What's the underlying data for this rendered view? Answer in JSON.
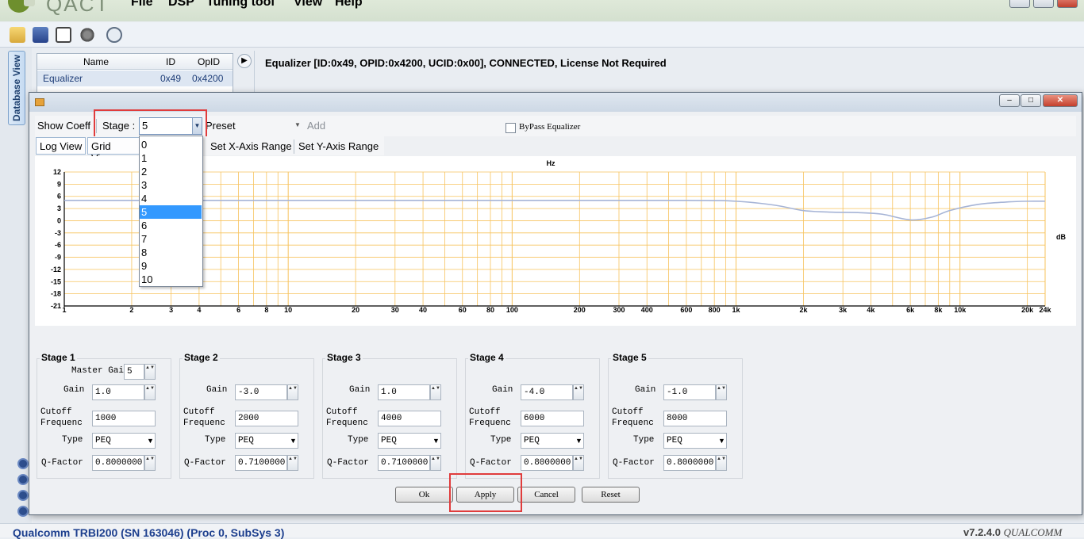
{
  "app": {
    "name": "QACT",
    "menu": [
      "File",
      "DSP",
      "Tuning tool",
      "View",
      "Help"
    ]
  },
  "sidebar": {
    "tab_label": "Database View"
  },
  "module_grid": {
    "headers": [
      "Name",
      "ID",
      "OpID"
    ],
    "rows": [
      {
        "name": "Equalizer",
        "id": "0x49",
        "opid": "0x4200"
      }
    ]
  },
  "main": {
    "header": "Equalizer [ID:0x49, OPID:0x4200, UCID:0x00], CONNECTED, License Not Required"
  },
  "dialog": {
    "toolbar": {
      "show_coeff": "Show Coeff",
      "stage_label": "Stage :",
      "stage_value": "5",
      "preset_label": "Preset",
      "add_label": "Add",
      "bypass_label": "ByPass Equalizer",
      "log_view": "Log View",
      "grid_view": "Grid View",
      "set_x": "Set X-Axis Range",
      "set_y": "Set Y-Axis Range"
    },
    "stage_options": [
      "0",
      "1",
      "2",
      "3",
      "4",
      "5",
      "6",
      "7",
      "8",
      "9",
      "10"
    ],
    "stage_selected_index": 5,
    "stages": [
      {
        "title": "Stage 1",
        "master_gain_label": "Master Gai",
        "master_gain": "5",
        "gain_label": "Gain",
        "gain": "1.0",
        "cutoff_label1": "Cutoff",
        "cutoff_label2": "Frequenc",
        "cutoff": "1000",
        "type_label": "Type",
        "type": "PEQ",
        "q_label": "Q-Factor",
        "q": "0.8000000"
      },
      {
        "title": "Stage 2",
        "gain_label": "Gain",
        "gain": "-3.0",
        "cutoff_label1": "Cutoff",
        "cutoff_label2": "Frequenc",
        "cutoff": "2000",
        "type_label": "Type",
        "type": "PEQ",
        "q_label": "Q-Factor",
        "q": "0.7100000"
      },
      {
        "title": "Stage 3",
        "gain_label": "Gain",
        "gain": "1.0",
        "cutoff_label1": "Cutoff",
        "cutoff_label2": "Frequenc",
        "cutoff": "4000",
        "type_label": "Type",
        "type": "PEQ",
        "q_label": "Q-Factor",
        "q": "0.7100000"
      },
      {
        "title": "Stage 4",
        "gain_label": "Gain",
        "gain": "-4.0",
        "cutoff_label1": "Cutoff",
        "cutoff_label2": "Frequenc",
        "cutoff": "6000",
        "type_label": "Type",
        "type": "PEQ",
        "q_label": "Q-Factor",
        "q": "0.8000000"
      },
      {
        "title": "Stage 5",
        "gain_label": "Gain",
        "gain": "-1.0",
        "cutoff_label1": "Cutoff",
        "cutoff_label2": "Frequenc",
        "cutoff": "8000",
        "type_label": "Type",
        "type": "PEQ",
        "q_label": "Q-Factor",
        "q": "0.8000000"
      }
    ],
    "buttons": {
      "ok": "Ok",
      "apply": "Apply",
      "cancel": "Cancel",
      "reset": "Reset"
    }
  },
  "status": {
    "left": "Qualcomm TRBI200 (SN 163046) (Proc 0, SubSys 3)",
    "version": "v7.2.4.0",
    "brand": "QUALCOMM"
  },
  "chart_data": {
    "type": "line",
    "xlabel": "Hz",
    "ylabel": "dB",
    "x_scale": "log",
    "xlim": [
      1,
      24000
    ],
    "ylim": [
      -21,
      12
    ],
    "x_ticks": [
      1,
      2,
      3,
      4,
      6,
      8,
      10,
      20,
      30,
      40,
      60,
      80,
      100,
      200,
      300,
      400,
      600,
      800,
      1000,
      2000,
      3000,
      4000,
      6000,
      8000,
      10000,
      20000,
      24000
    ],
    "x_tick_labels": [
      "1",
      "2",
      "3",
      "4",
      "6",
      "8",
      "10",
      "20",
      "30",
      "40",
      "60",
      "80",
      "100",
      "200",
      "300",
      "400",
      "600",
      "800",
      "1k",
      "2k",
      "3k",
      "4k",
      "6k",
      "8k",
      "10k",
      "20k",
      "24k"
    ],
    "y_ticks": [
      12,
      9,
      6,
      3,
      0,
      -3,
      -6,
      -9,
      -12,
      -15,
      -18,
      -21
    ],
    "grid": true,
    "series": [
      {
        "x": [
          1,
          100,
          600,
          1000,
          1500,
          2000,
          2700,
          3500,
          4500,
          6000,
          7500,
          9000,
          12000,
          16000,
          20000,
          24000
        ],
        "y": [
          5.0,
          5.0,
          5.0,
          4.8,
          3.8,
          2.5,
          2.1,
          2.0,
          1.6,
          0.2,
          0.9,
          2.5,
          4.0,
          4.6,
          4.8,
          4.8
        ]
      }
    ],
    "line_color": "#a6b4d6",
    "grid_color": "#f7c35e"
  }
}
